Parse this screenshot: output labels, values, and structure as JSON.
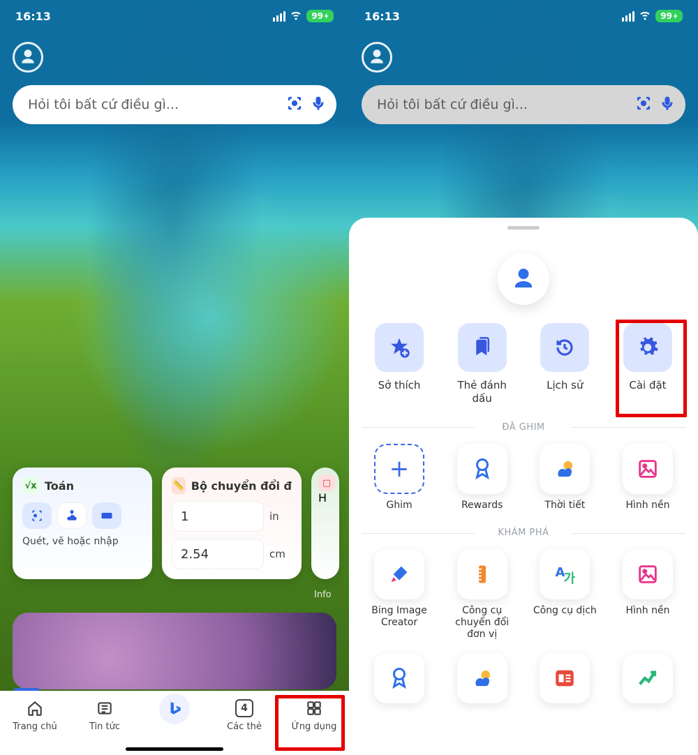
{
  "status": {
    "time": "16:13",
    "battery": "99"
  },
  "search": {
    "placeholder": "Hỏi tôi bất cứ điều gì..."
  },
  "left": {
    "math": {
      "title": "Toán",
      "hint": "Quét, vẽ hoặc nhập",
      "badge": "√x"
    },
    "converter": {
      "title": "Bộ chuyển đổi đ",
      "value1": "1",
      "unit1": "in",
      "value2": "2.54",
      "unit2": "cm"
    },
    "side_card": "H",
    "info": "Info"
  },
  "tabs": {
    "home": "Trang chủ",
    "news": "Tin tức",
    "tabs_count": "4",
    "tabs_label": "Các thẻ",
    "apps": "Ứng dụng"
  },
  "sheet": {
    "quick": {
      "interests": "Sở thích",
      "bookmarks": "Thẻ đánh dấu",
      "history": "Lịch sử",
      "settings": "Cài đặt"
    },
    "section_pinned": "ĐÃ GHIM",
    "pinned": {
      "pin": "Ghim",
      "rewards": "Rewards",
      "weather": "Thời tiết",
      "wallpaper": "Hình nền"
    },
    "section_explore": "KHÁM PHÁ",
    "explore": {
      "image_creator": "Bing Image Creator",
      "unit_converter": "Công cụ chuyển đổi đơn vị",
      "translator": "Công cụ dịch",
      "wallpaper": "Hình nền"
    }
  },
  "colors": {
    "accent": "#2f6fe8",
    "highlight": "#e60000"
  }
}
